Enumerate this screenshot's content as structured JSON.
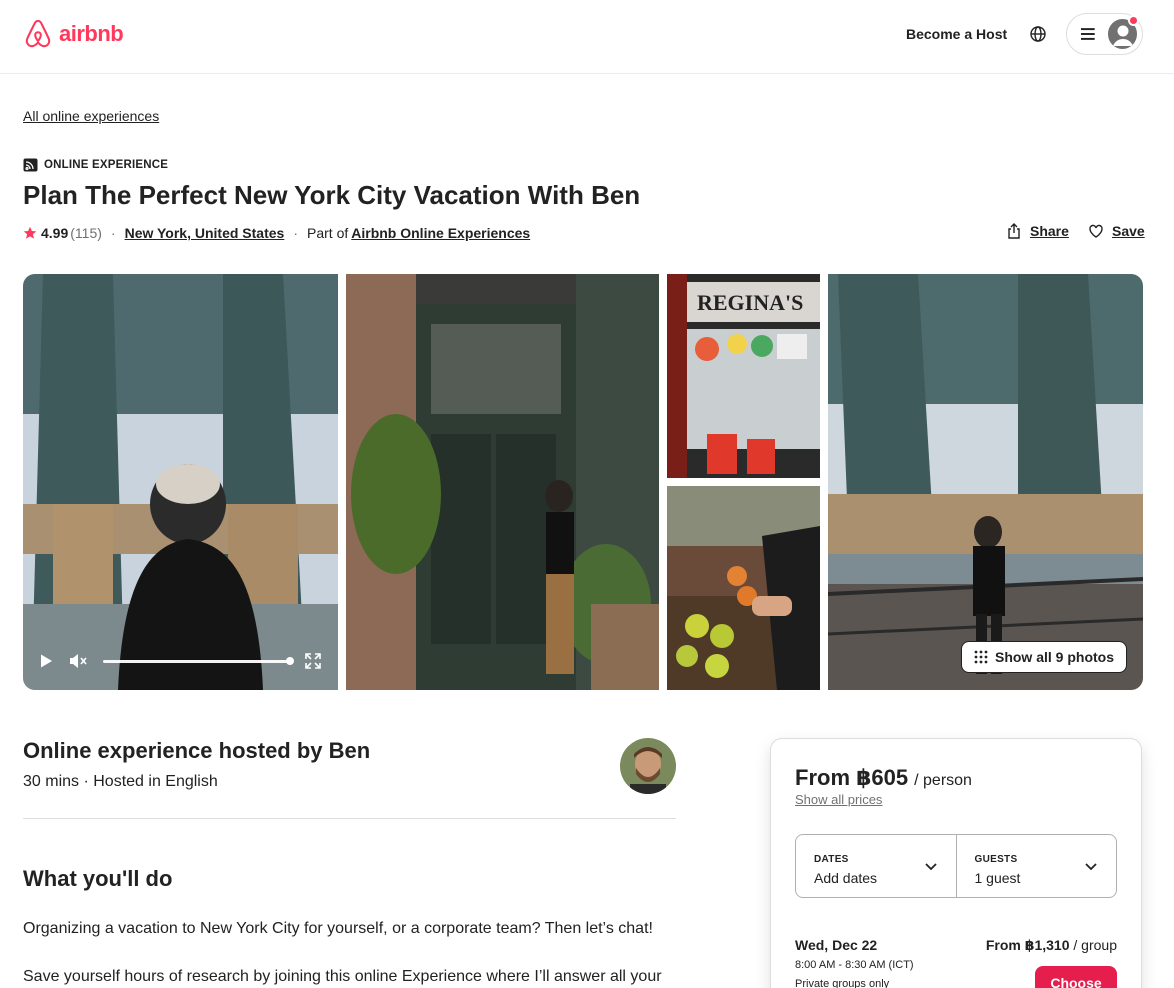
{
  "header": {
    "logo_text": "airbnb",
    "become_host": "Become a Host",
    "brand_color": "#FF385C"
  },
  "breadcrumb": "All online experiences",
  "listing": {
    "type_label": "ONLINE EXPERIENCE",
    "title": "Plan The Perfect New York City Vacation With Ben",
    "rating": "4.99",
    "reviews": "(115)",
    "location": "New York, United States",
    "part_of_prefix": "Part of",
    "part_of_link": "Airbnb Online Experiences",
    "share": "Share",
    "save": "Save"
  },
  "gallery": {
    "show_all": "Show all 9 photos",
    "photos": [
      "bridge-video",
      "doorway",
      "reginas-storefront",
      "fruit-market",
      "bridge-railing"
    ]
  },
  "host": {
    "title": "Online experience hosted by Ben",
    "subtitle": "30 mins · Hosted in English"
  },
  "what_youll_do": {
    "title": "What you'll do",
    "p1": "Organizing a vacation to New York City for yourself, or a corporate team? Then let’s chat!",
    "p2": "Save yourself hours of research by joining this online Experience where I’ll answer all your"
  },
  "booking": {
    "price": "From ฿605",
    "price_unit": "/ person",
    "show_all_prices": "Show all prices",
    "dates_label": "DATES",
    "dates_value": "Add dates",
    "guests_label": "GUESTS",
    "guests_value": "1 guest",
    "slot": {
      "date": "Wed, Dec 22",
      "time": "8:00 AM - 8:30 AM (ICT)",
      "note": "Private groups only",
      "price_prefix": "From ฿1,310",
      "price_unit": "/ group",
      "choose": "Choose"
    },
    "accent_color": "#E61E4D"
  }
}
